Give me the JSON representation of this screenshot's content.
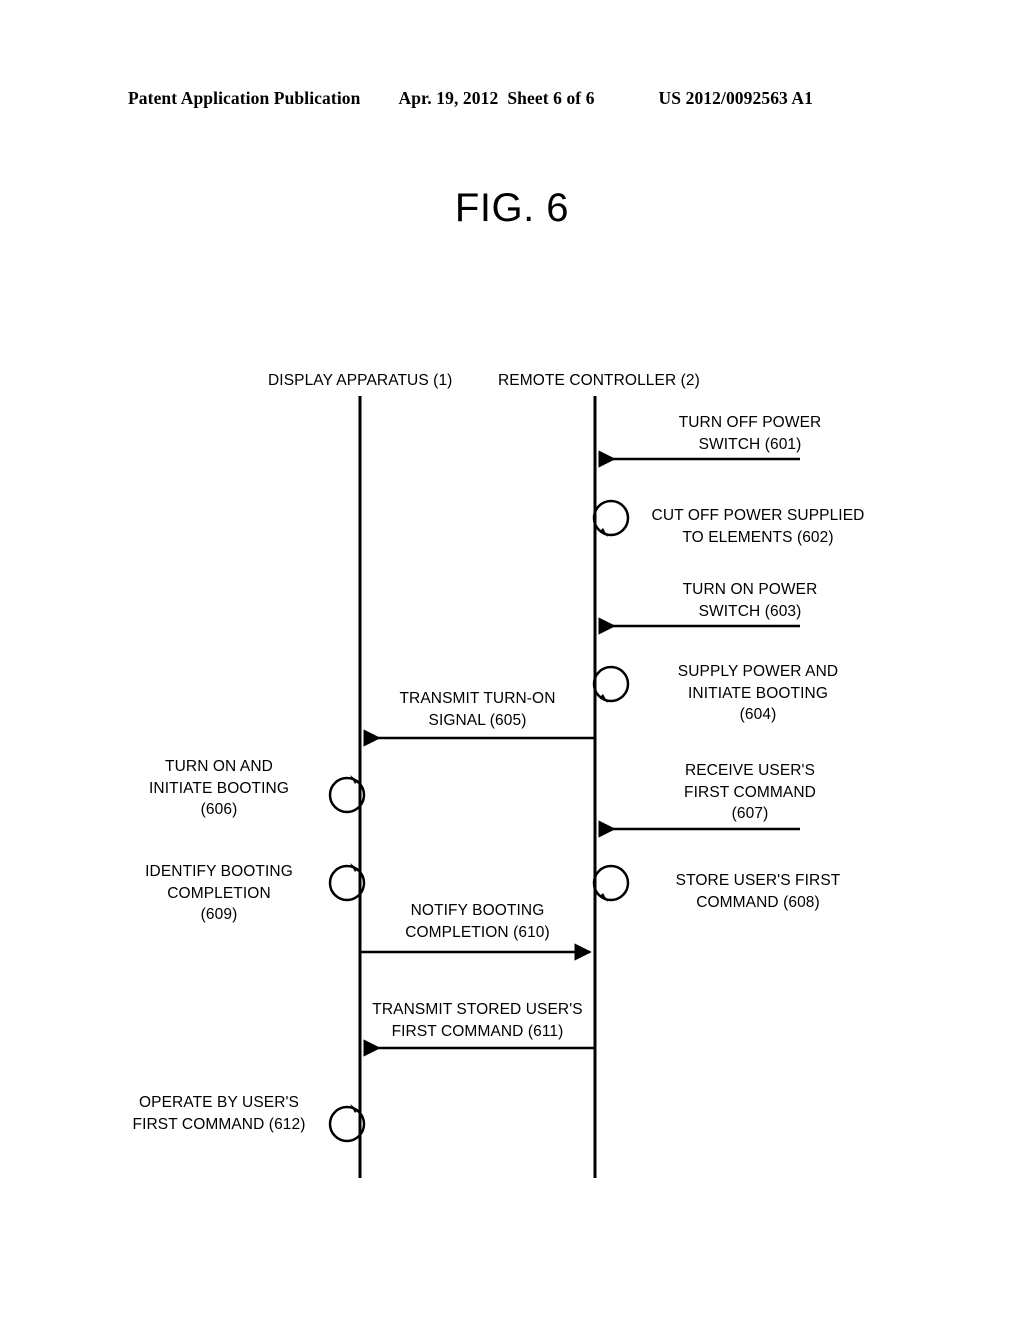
{
  "header": {
    "publication": "Patent Application Publication",
    "date": "Apr. 19, 2012",
    "sheet": "Sheet 6 of 6",
    "patent_number": "US 2012/0092563 A1"
  },
  "figure": {
    "title": "FIG. 6",
    "type": "sequence-diagram"
  },
  "lanes": [
    {
      "id": "display-apparatus",
      "label": "DISPLAY APPARATUS (1)"
    },
    {
      "id": "remote-controller",
      "label": "REMOTE CONTROLLER (2)"
    }
  ],
  "steps": [
    {
      "ref": "601",
      "kind": "message",
      "actor": "remote-controller",
      "direction": "left",
      "lines": [
        "TURN OFF POWER",
        "SWITCH (601)"
      ]
    },
    {
      "ref": "602",
      "kind": "self-loop",
      "actor": "remote-controller",
      "lines": [
        "CUT OFF POWER SUPPLIED",
        "TO ELEMENTS (602)"
      ]
    },
    {
      "ref": "603",
      "kind": "message",
      "actor": "remote-controller",
      "direction": "left",
      "lines": [
        "TURN ON POWER",
        "SWITCH (603)"
      ]
    },
    {
      "ref": "604",
      "kind": "self-loop",
      "actor": "remote-controller",
      "lines": [
        "SUPPLY POWER AND",
        "INITIATE BOOTING",
        "(604)"
      ]
    },
    {
      "ref": "605",
      "kind": "message",
      "from": "remote-controller",
      "to": "display-apparatus",
      "direction": "left",
      "lines": [
        "TRANSMIT TURN-ON",
        "SIGNAL (605)"
      ]
    },
    {
      "ref": "606",
      "kind": "self-loop",
      "actor": "display-apparatus",
      "lines": [
        "TURN ON AND",
        "INITIATE BOOTING",
        "(606)"
      ]
    },
    {
      "ref": "607",
      "kind": "message",
      "actor": "remote-controller",
      "direction": "left",
      "lines": [
        "RECEIVE USER'S",
        "FIRST COMMAND",
        "(607)"
      ]
    },
    {
      "ref": "608",
      "kind": "self-loop",
      "actor": "remote-controller",
      "lines": [
        "STORE USER'S FIRST",
        "COMMAND (608)"
      ]
    },
    {
      "ref": "609",
      "kind": "self-loop",
      "actor": "display-apparatus",
      "lines": [
        "IDENTIFY BOOTING",
        "COMPLETION",
        "(609)"
      ]
    },
    {
      "ref": "610",
      "kind": "message",
      "from": "display-apparatus",
      "to": "remote-controller",
      "direction": "right",
      "lines": [
        "NOTIFY BOOTING",
        "COMPLETION (610)"
      ]
    },
    {
      "ref": "611",
      "kind": "message",
      "from": "remote-controller",
      "to": "display-apparatus",
      "direction": "left",
      "lines": [
        "TRANSMIT STORED USER'S",
        "FIRST COMMAND (611)"
      ]
    },
    {
      "ref": "612",
      "kind": "self-loop",
      "actor": "display-apparatus",
      "lines": [
        "OPERATE BY USER'S",
        "FIRST COMMAND (612)"
      ]
    }
  ]
}
